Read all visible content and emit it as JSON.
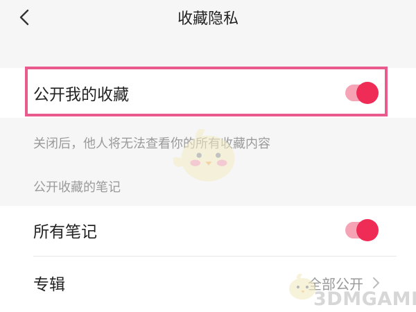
{
  "header": {
    "title": "收藏隐私"
  },
  "public_favorites": {
    "label": "公开我的收藏",
    "enabled": true
  },
  "hint_text": "关闭后，他人将无法查看你的所有收藏内容",
  "section_title": "公开收藏的笔记",
  "all_notes": {
    "label": "所有笔记",
    "enabled": true
  },
  "albums": {
    "label": "专辑",
    "value": "全部公开"
  },
  "watermark": {
    "text": "3DMGAME"
  },
  "colors": {
    "accent": "#ee2c55",
    "toggle_track": "#f6a3b5",
    "highlight": "#ea5b8d"
  },
  "icons": {
    "back": "chevron-left-icon",
    "arrow": "chevron-right-icon"
  }
}
